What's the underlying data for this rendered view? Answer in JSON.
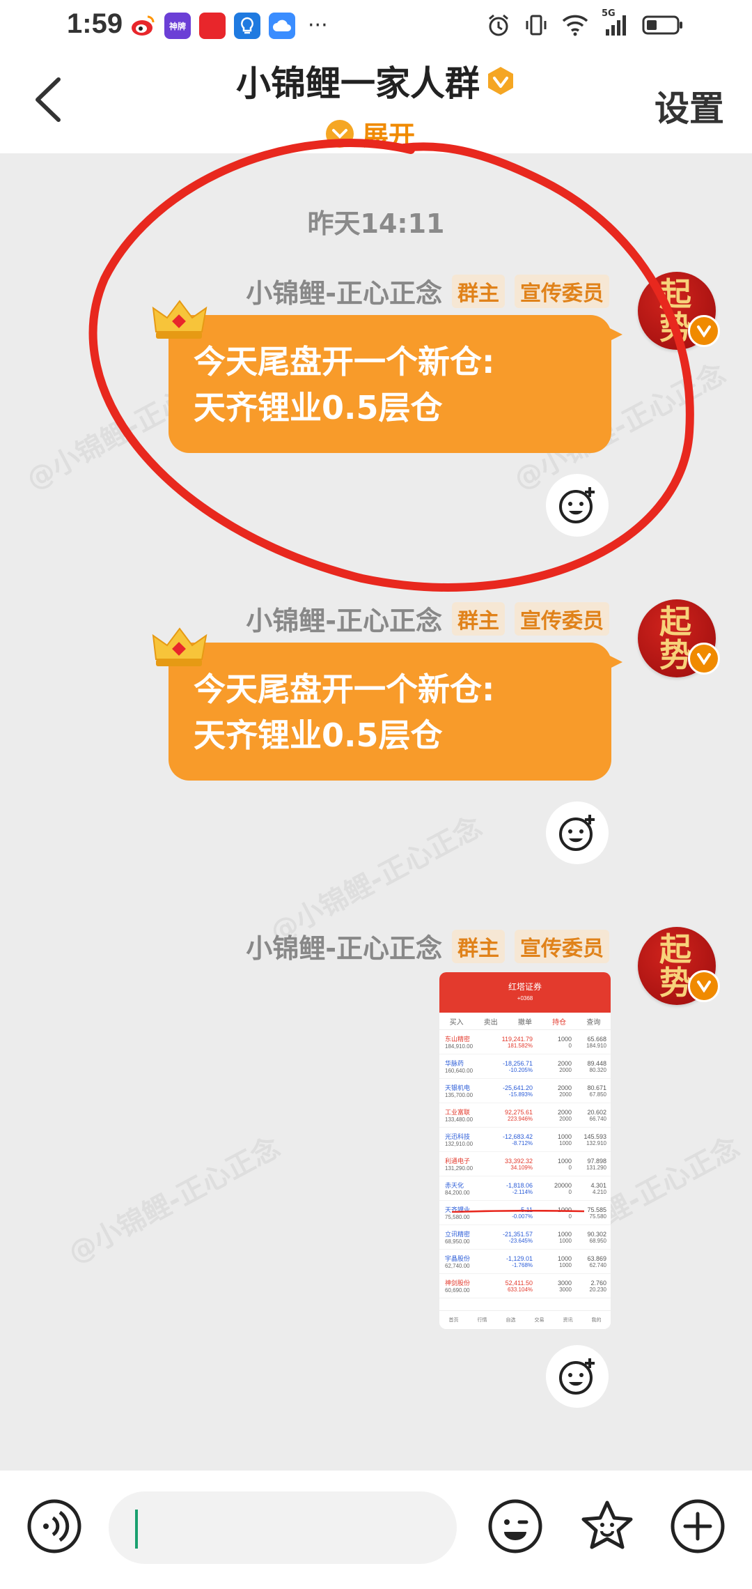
{
  "status_bar": {
    "time": "1:59",
    "apps": [
      {
        "name": "weibo-icon",
        "label": "",
        "color": "#ff8a00"
      },
      {
        "name": "shenzhan-icon",
        "label": "神牌",
        "color": "#6b3fd6"
      },
      {
        "name": "app-red-icon",
        "label": "",
        "color": "#e8262b"
      },
      {
        "name": "bulb-icon",
        "label": "",
        "color": "#1f7ae0"
      },
      {
        "name": "cloud-icon",
        "label": "",
        "color": "#3a8dff"
      }
    ],
    "more": "···",
    "network": "5G"
  },
  "header": {
    "title": "小锦鲤一家人群",
    "settings_label": "设置",
    "expand_label": "展开"
  },
  "chat": {
    "timestamp": "昨天14:11",
    "watermark": "@小锦鲤-正心正念",
    "messages": [
      {
        "sender": "小锦鲤-正心正念",
        "tags": [
          "群主",
          "宣传委员"
        ],
        "text": "今天尾盘开一个新仓:\n天齐锂业0.5层仓",
        "avatar_text": "起势"
      },
      {
        "sender": "小锦鲤-正心正念",
        "tags": [
          "群主",
          "宣传委员"
        ],
        "text": "今天尾盘开一个新仓:\n天齐锂业0.5层仓",
        "avatar_text": "起势"
      },
      {
        "sender": "小锦鲤-正心正念",
        "tags": [
          "群主",
          "宣传委员"
        ],
        "avatar_text": "起势",
        "screenshot": {
          "app_title": "红塔证券",
          "account": "+0368",
          "tabs": [
            "买入",
            "卖出",
            "撤单",
            "持仓",
            "查询"
          ],
          "active_tab": "持仓",
          "rows": [
            {
              "name": "东山精密",
              "mv": "184,910.00",
              "pl": "119,241.79",
              "pct": "181.582%",
              "qty": "1000",
              "avail": "0",
              "cost": "65.668",
              "price": "184.910",
              "color": "red"
            },
            {
              "name": "华脉药",
              "mv": "160,640.00",
              "pl": "-18,256.71",
              "pct": "-10.205%",
              "qty": "2000",
              "avail": "2000",
              "cost": "89.448",
              "price": "80.320",
              "color": "blue"
            },
            {
              "name": "天银机电",
              "mv": "135,700.00",
              "pl": "-25,641.20",
              "pct": "-15.893%",
              "qty": "2000",
              "avail": "2000",
              "cost": "80.671",
              "price": "67.850",
              "color": "blue"
            },
            {
              "name": "工业富联",
              "mv": "133,480.00",
              "pl": "92,275.61",
              "pct": "223.946%",
              "qty": "2000",
              "avail": "2000",
              "cost": "20.602",
              "price": "66.740",
              "color": "red"
            },
            {
              "name": "光迅科技",
              "mv": "132,910.00",
              "pl": "-12,683.42",
              "pct": "-8.712%",
              "qty": "1000",
              "avail": "1000",
              "cost": "145.593",
              "price": "132.910",
              "color": "blue"
            },
            {
              "name": "利通电子",
              "mv": "131,290.00",
              "pl": "33,392.32",
              "pct": "34.109%",
              "qty": "1000",
              "avail": "0",
              "cost": "97.898",
              "price": "131.290",
              "color": "red"
            },
            {
              "name": "赤天化",
              "mv": "84,200.00",
              "pl": "-1,818.06",
              "pct": "-2.114%",
              "qty": "20000",
              "avail": "0",
              "cost": "4.301",
              "price": "4.210",
              "color": "blue"
            },
            {
              "name": "天齐锂业",
              "mv": "75,580.00",
              "pl": "-5.11",
              "pct": "-0.007%",
              "qty": "1000",
              "avail": "0",
              "cost": "75.585",
              "price": "75.580",
              "color": "blue"
            },
            {
              "name": "立讯精密",
              "mv": "68,950.00",
              "pl": "-21,351.57",
              "pct": "-23.645%",
              "qty": "1000",
              "avail": "1000",
              "cost": "90.302",
              "price": "68.950",
              "color": "blue"
            },
            {
              "name": "宇晶股份",
              "mv": "62,740.00",
              "pl": "-1,129.01",
              "pct": "-1.768%",
              "qty": "1000",
              "avail": "1000",
              "cost": "63.869",
              "price": "62.740",
              "color": "blue"
            },
            {
              "name": "神剑股份",
              "mv": "60,690.00",
              "pl": "52,411.50",
              "pct": "633.104%",
              "qty": "3000",
              "avail": "3000",
              "cost": "2.760",
              "price": "20.230",
              "color": "red"
            }
          ],
          "nav": [
            "首页",
            "行情",
            "自选",
            "交易",
            "资讯",
            "我的"
          ]
        }
      }
    ]
  },
  "input_bar": {
    "text_value": "",
    "placeholder": ""
  },
  "colors": {
    "bubble": "#f89b2a",
    "accent": "#f08a00",
    "annotation_circle": "#e8281e",
    "tag_text": "#e0821a"
  }
}
